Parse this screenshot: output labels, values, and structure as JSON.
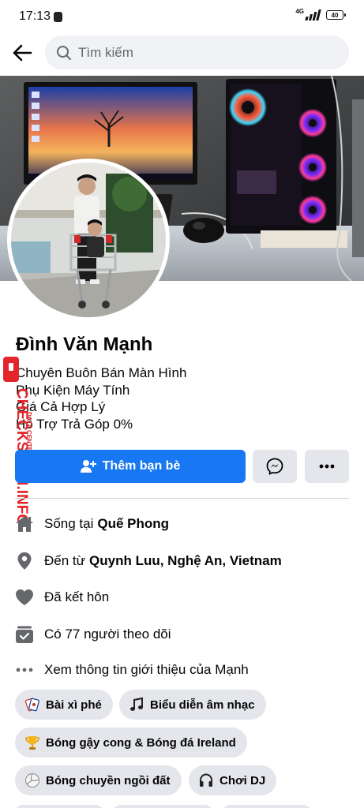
{
  "status_bar": {
    "time": "17:13",
    "network": "4G",
    "battery": "40"
  },
  "search": {
    "placeholder": "Tìm kiếm"
  },
  "profile": {
    "name": "Đình Văn Mạnh",
    "bio": [
      "Chuyên Buôn Bán Màn Hình",
      "Phụ Kiện Máy Tính",
      "Giá Cả Hợp Lý",
      "Hỗ Trợ Trả Góp 0%"
    ]
  },
  "actions": {
    "add_friend_label": "Thêm bạn bè"
  },
  "intro": [
    {
      "icon": "home-icon",
      "prefix": "Sống tại",
      "value": "Quế Phong"
    },
    {
      "icon": "location-pin-icon",
      "prefix": "Đến từ",
      "value": "Quynh Luu, Nghệ An, Vietnam"
    },
    {
      "icon": "heart-icon",
      "prefix": "Đã kết hôn",
      "value": ""
    },
    {
      "icon": "followers-icon",
      "prefix": "Có 77 người theo dõi",
      "value": ""
    },
    {
      "icon": "more-dots-icon",
      "prefix": "Xem thông tin giới thiệu của Mạnh",
      "value": ""
    }
  ],
  "hobbies": [
    {
      "icon": "cards-icon",
      "label": "Bài xì phé"
    },
    {
      "icon": "music-note-icon",
      "label": "Biểu diễn âm nhạc"
    },
    {
      "icon": "trophy-icon",
      "label": "Bóng gậy cong & Bóng đá Ireland"
    },
    {
      "icon": "volleyball-icon",
      "label": "Bóng chuyền ngồi đất"
    },
    {
      "icon": "headphones-icon",
      "label": "Chơi DJ"
    }
  ],
  "watermark": {
    "text": "CHECKSCAM.INFO",
    "subtext": "DATA CENTER"
  },
  "colors": {
    "primary": "#1877f2",
    "button_gray": "#e4e6eb",
    "search_bg": "#f0f2f5",
    "icon_gray": "#65676b"
  }
}
